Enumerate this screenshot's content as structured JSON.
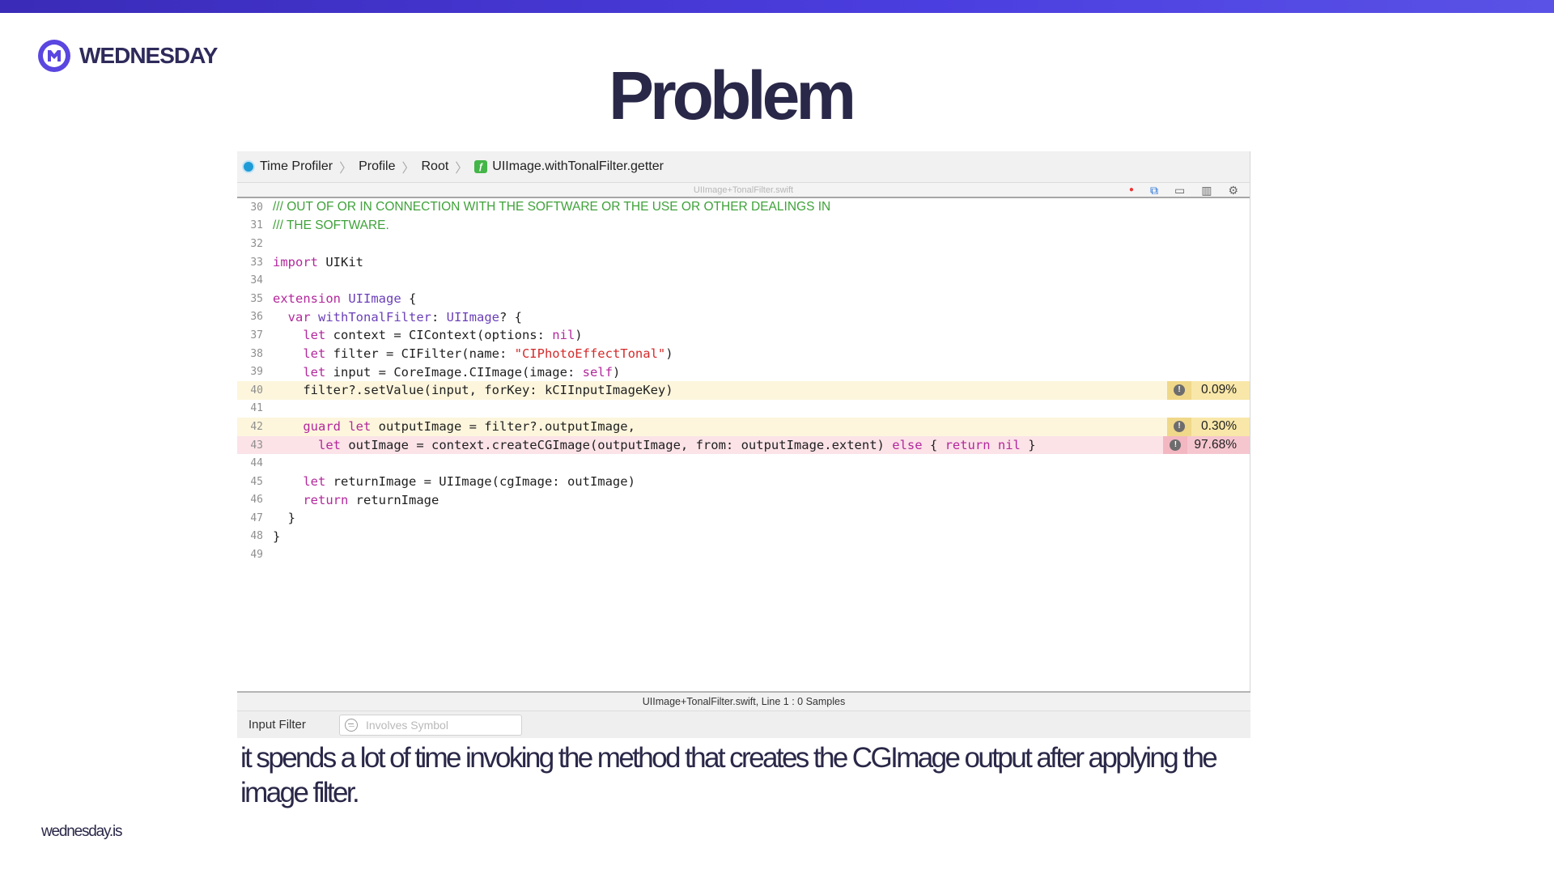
{
  "slide": {
    "brand": "WEDNESDAY",
    "title": "Problem",
    "caption": "it spends a lot of time invoking the method that creates the CGImage output after applying the image filter.",
    "footer": "wednesday.is",
    "accent_color": "#4b3ee0"
  },
  "instruments": {
    "breadcrumbs": [
      "Time Profiler",
      "Profile",
      "Root",
      "UIImage.withTonalFilter.getter"
    ],
    "file_name": "UIImage+TonalFilter.swift",
    "status": "UIImage+TonalFilter.swift, Line 1 : 0 Samples",
    "filter_label": "Input Filter",
    "filter_placeholder": "Involves Symbol",
    "lines": [
      {
        "n": "30"
      },
      {
        "n": "31"
      },
      {
        "n": "32"
      },
      {
        "n": "33"
      },
      {
        "n": "34"
      },
      {
        "n": "35"
      },
      {
        "n": "36"
      },
      {
        "n": "37"
      },
      {
        "n": "38"
      },
      {
        "n": "39"
      },
      {
        "n": "40"
      },
      {
        "n": "41"
      },
      {
        "n": "42"
      },
      {
        "n": "43"
      },
      {
        "n": "44"
      },
      {
        "n": "45"
      },
      {
        "n": "46"
      },
      {
        "n": "47"
      },
      {
        "n": "48"
      },
      {
        "n": "49"
      }
    ],
    "code": {
      "l30": "/// OUT OF OR IN CONNECTION WITH THE SOFTWARE OR THE USE OR OTHER DEALINGS IN",
      "l31": "/// THE SOFTWARE.",
      "l33_kw": "import",
      "l33_rest": " UIKit",
      "l35_kw": "extension",
      "l35_ty": " UIImage",
      "l35_rest": " {",
      "l36_ind": "  ",
      "l36_kw": "var",
      "l36_name": " withTonalFilter",
      "l36_p": ": ",
      "l36_ty": "UIImage",
      "l36_rest": "? {",
      "l37_ind": "    ",
      "l37_kw": "let",
      "l37_a": " context = CIContext(options: ",
      "l37_nil": "nil",
      "l37_b": ")",
      "l38_ind": "    ",
      "l38_kw": "let",
      "l38_a": " filter = CIFilter(name: ",
      "l38_str": "\"CIPhotoEffectTonal\"",
      "l38_b": ")",
      "l39_ind": "    ",
      "l39_kw": "let",
      "l39_a": " input = CoreImage.CIImage(image: ",
      "l39_self": "self",
      "l39_b": ")",
      "l40": "    filter?.setValue(input, forKey: kCIInputImageKey)",
      "l42_ind": "    ",
      "l42_kw": "guard",
      "l42_kw2": " let",
      "l42_a": " outputImage = filter?.outputImage,",
      "l43_ind": "      ",
      "l43_kw": "let",
      "l43_a": " outImage = context.createCGImage(outputImage, from: outputImage.extent) ",
      "l43_else": "else",
      "l43_b": " { ",
      "l43_ret": "return",
      "l43_nil": " nil",
      "l43_c": " }",
      "l45_ind": "    ",
      "l45_kw": "let",
      "l45_a": " returnImage = UIImage(cgImage: outImage)",
      "l46_ind": "    ",
      "l46_kw": "return",
      "l46_a": " returnImage",
      "l47": "  }",
      "l48": "}"
    },
    "costs": {
      "l40": "0.09%",
      "l42": "0.30%",
      "l43": "97.68%"
    }
  }
}
